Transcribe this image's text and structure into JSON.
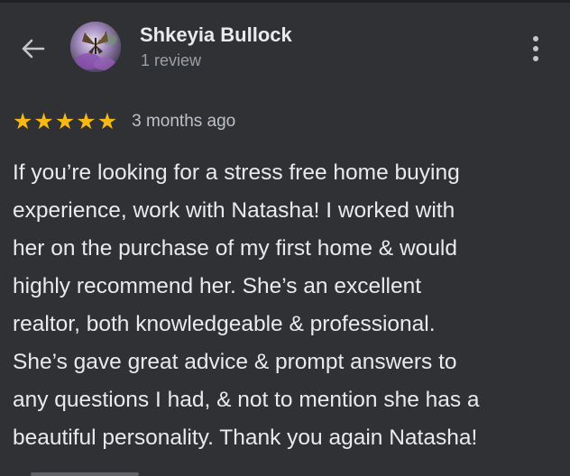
{
  "header": {
    "reviewer_name": "Shkeyia Bullock",
    "review_count": "1 review",
    "back_icon": "arrow-left-icon",
    "more_icon": "more-vert-icon"
  },
  "review": {
    "rating": 5,
    "rating_max": 5,
    "stars": [
      "★",
      "★",
      "★",
      "★",
      "★"
    ],
    "star_color": "#f9b915",
    "time": "3 months ago",
    "text_lines": [
      "If you’re looking for a stress free home buying",
      "experience, work with Natasha! I worked with",
      "her on the purchase of my first home & would",
      "highly recommend her. She’s an excellent",
      "realtor, both knowledgeable & professional.",
      "She’s gave great advice & prompt answers to",
      "any questions I had, & not to mention she has a",
      "beautiful personality. Thank you again Natasha!"
    ]
  },
  "colors": {
    "background": "#303134",
    "text_primary": "#e8eaed",
    "text_secondary": "#9aa0a6"
  }
}
